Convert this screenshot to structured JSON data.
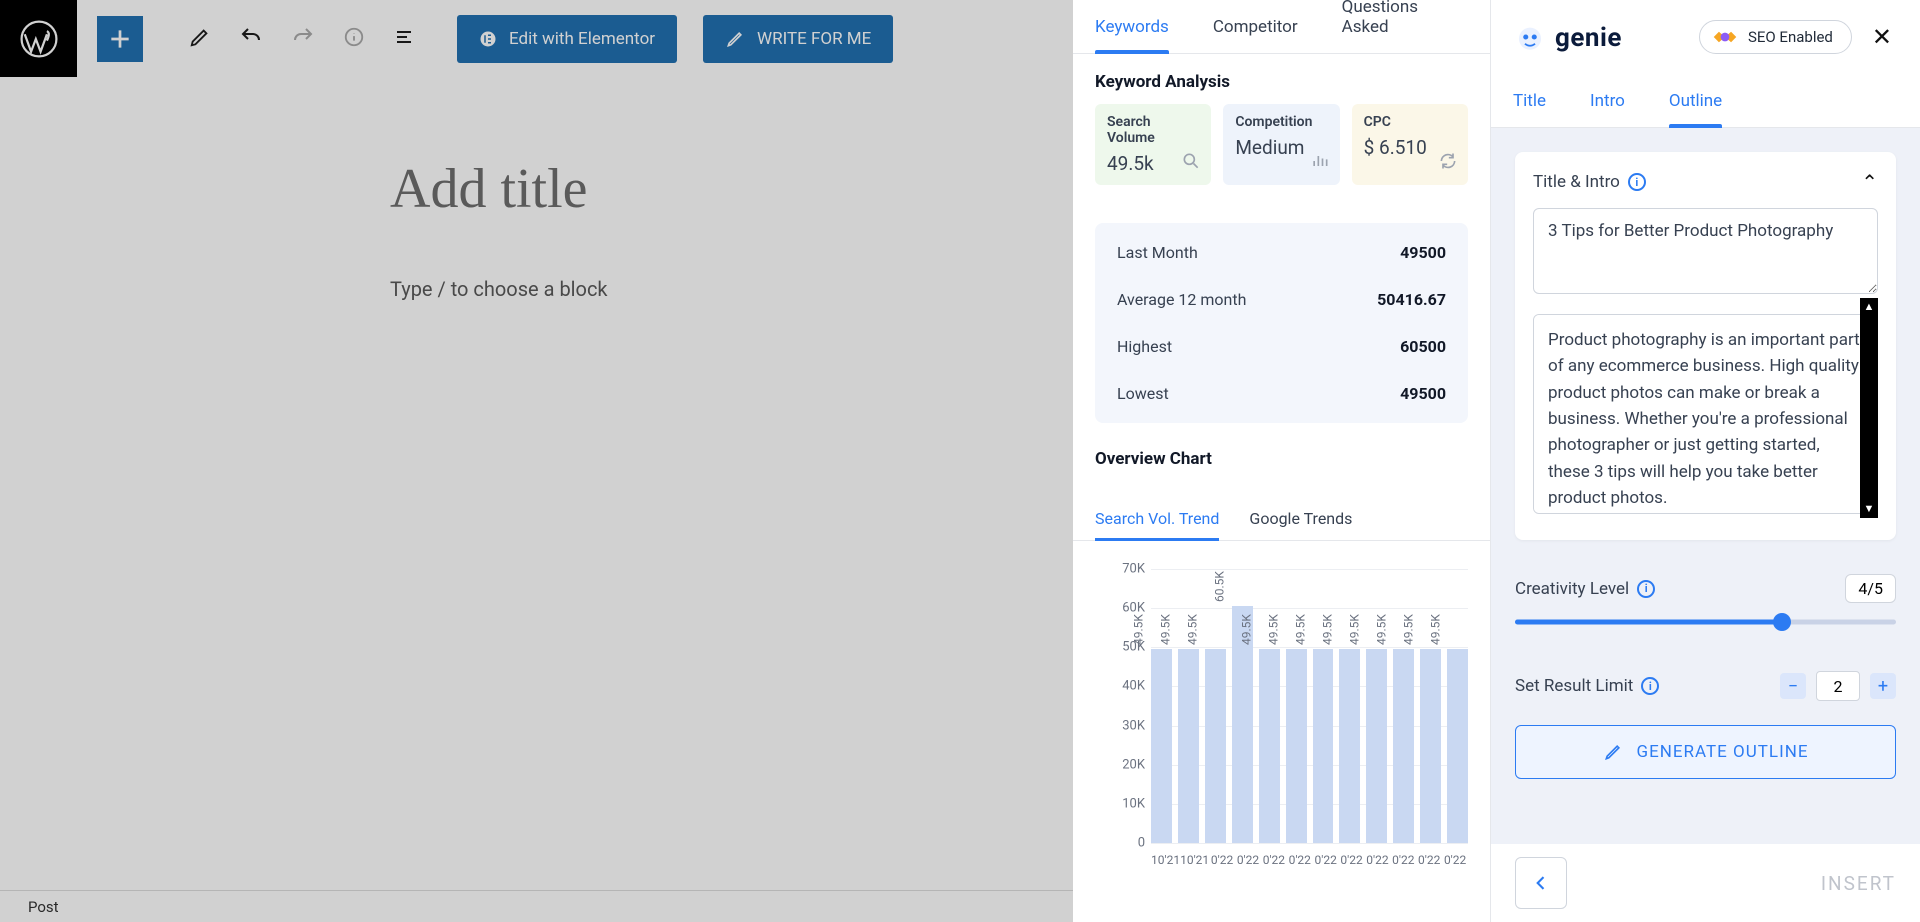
{
  "wp": {
    "title_placeholder": "Add title",
    "block_placeholder": "Type / to choose a block",
    "elementor_label": "Edit with Elementor",
    "write_label": "WRITE FOR ME",
    "footer": "Post"
  },
  "brand": {
    "name": "genie",
    "seo_label": "SEO Enabled"
  },
  "left_tabs": [
    "Keywords",
    "Competitor",
    "Questions Asked"
  ],
  "analysis": {
    "heading": "Keyword Analysis",
    "cards": {
      "volume": {
        "label": "Search Volume",
        "value": "49.5k"
      },
      "competition": {
        "label": "Competition",
        "value": "Medium"
      },
      "cpc": {
        "label": "CPC",
        "value": "$ 6.510"
      }
    },
    "stats": {
      "last_month": {
        "label": "Last Month",
        "value": "49500"
      },
      "avg12": {
        "label": "Average 12 month",
        "value": "50416.67"
      },
      "highest": {
        "label": "Highest",
        "value": "60500"
      },
      "lowest": {
        "label": "Lowest",
        "value": "49500"
      }
    }
  },
  "overview": {
    "heading": "Overview Chart",
    "tabs": [
      "Search Vol. Trend",
      "Google Trends"
    ]
  },
  "chart_data": {
    "type": "bar",
    "categories": [
      "10'21",
      "10'21",
      "0'22",
      "0'22",
      "0'22",
      "0'22",
      "0'22",
      "0'22",
      "0'22",
      "0'22",
      "0'22",
      "0'22"
    ],
    "values": [
      49500,
      49500,
      49500,
      60500,
      49500,
      49500,
      49500,
      49500,
      49500,
      49500,
      49500,
      49500
    ],
    "value_labels": [
      "49.5K",
      "49.5K",
      "49.5K",
      "60.5K",
      "49.5K",
      "49.5K",
      "49.5K",
      "49.5K",
      "49.5K",
      "49.5K",
      "49.5K",
      "49.5K"
    ],
    "y_ticks": [
      0,
      10000,
      20000,
      30000,
      40000,
      50000,
      60000,
      70000
    ],
    "y_tick_labels": [
      "0",
      "10K",
      "20K",
      "30K",
      "40K",
      "50K",
      "60K",
      "70K"
    ],
    "ylim": [
      0,
      70000
    ],
    "title": "",
    "xlabel": "",
    "ylabel": ""
  },
  "right_tabs": [
    "Title",
    "Intro",
    "Outline"
  ],
  "outline": {
    "section_title": "Title & Intro",
    "title_value": "3 Tips for Better Product Photography",
    "intro_value": "Product photography is an important part of any ecommerce business. High quality product photos can make or break a business. Whether you're a professional photographer or just getting started, these 3 tips will help you take better product photos.",
    "creativity_label": "Creativity Level",
    "creativity_display": "4/5",
    "creativity_value": 4,
    "creativity_max": 5,
    "result_label": "Set Result Limit",
    "result_value": "2",
    "generate_label": "GENERATE OUTLINE",
    "insert_label": "INSERT"
  }
}
